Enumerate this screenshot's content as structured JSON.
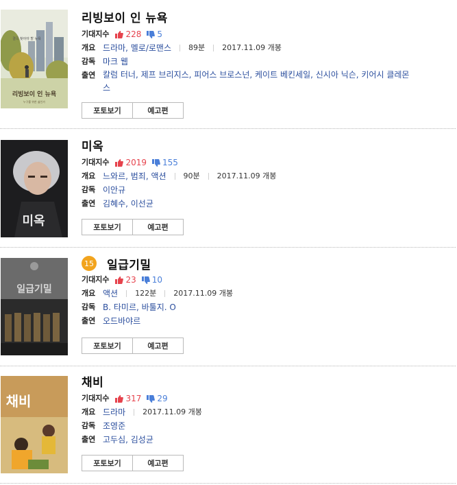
{
  "labels": {
    "expect": "기대지수",
    "overview": "개요",
    "director": "감독",
    "cast": "출연",
    "photo_button": "포토보기",
    "trailer_button": "예고편"
  },
  "colors": {
    "like": "#e6434d",
    "dislike": "#4a7fd9",
    "link": "#2c4f9e",
    "age_badge": "#f2a41e"
  },
  "movies": [
    {
      "title": "리빙보이 인 뉴욕",
      "likes": "228",
      "dislikes": "5",
      "genre": "드라마, 멜로/로맨스",
      "runtime": "89분",
      "release": "2017.11.09 개봉",
      "director": "마크 웹",
      "cast": "칼럼 터너, 제프 브리지스, 피어스 브로스넌, 케이트 베킨세일, 신시아 닉슨, 키어시 클레몬스",
      "poster_text": "리빙보이 인 뉴욕",
      "poster_sub": "누구를 위한 삶인가",
      "poster_tagline": "결국 찾아야 할 뉴욕"
    },
    {
      "title": "미옥",
      "likes": "2019",
      "dislikes": "155",
      "genre": "느와르, 범죄, 액션",
      "runtime": "90분",
      "release": "2017.11.09 개봉",
      "director": "이안규",
      "cast": "김혜수, 이선균",
      "poster_text": "미옥"
    },
    {
      "title": "일급기밀",
      "age": "15",
      "likes": "23",
      "dislikes": "10",
      "genre": "액션",
      "runtime": "122분",
      "release": "2017.11.09 개봉",
      "director": "B. 타미르, 바툴지. O",
      "cast": "오드바야르",
      "poster_text": "일급기밀"
    },
    {
      "title": "채비",
      "likes": "317",
      "dislikes": "29",
      "genre": "드라마",
      "release": "2017.11.09 개봉",
      "director": "조영준",
      "cast": "고두심, 김성균",
      "poster_text": "채비"
    }
  ]
}
